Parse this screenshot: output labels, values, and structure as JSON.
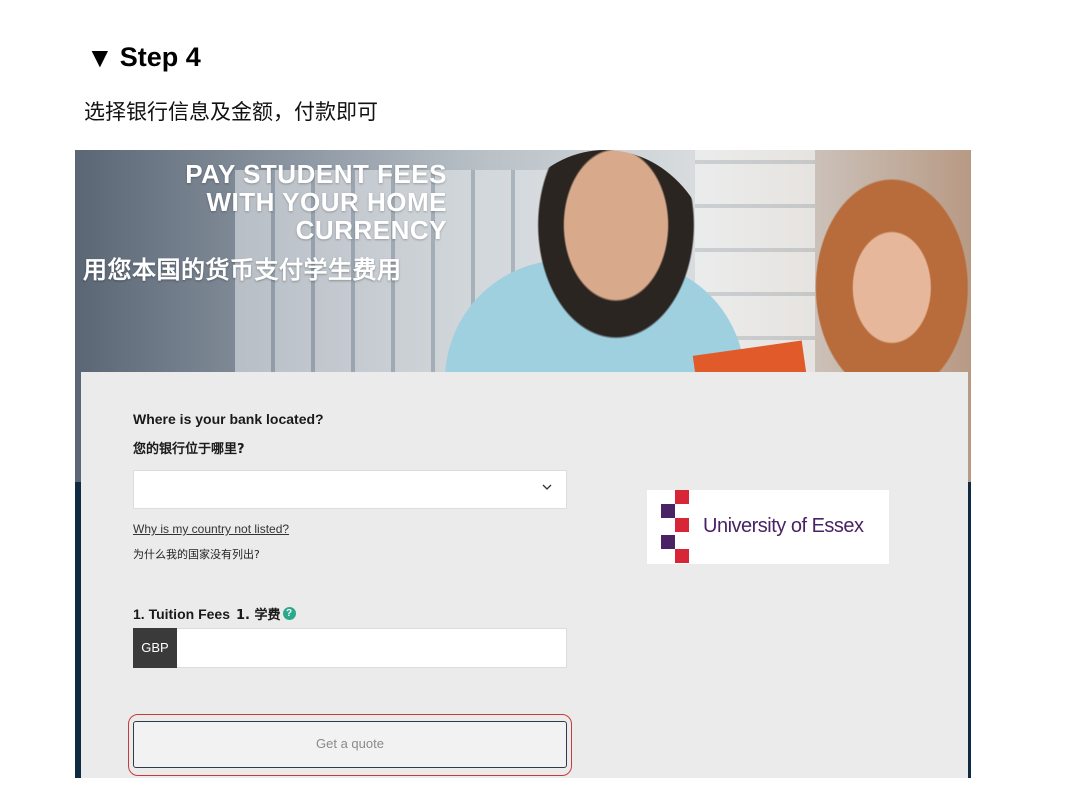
{
  "step": {
    "marker": "▼",
    "title": "Step 4",
    "description": "选择银行信息及金额，付款即可"
  },
  "hero": {
    "lines_en": [
      "PAY STUDENT FEES",
      "WITH YOUR HOME",
      "CURRENCY"
    ],
    "line_cn": "用您本国的货币支付学生费用"
  },
  "form": {
    "bank_label_en": "Where is your bank located?",
    "bank_label_cn": "您的银行位于哪里?",
    "bank_select_value": "",
    "chevron_icon": "chevron-down-icon",
    "country_link_en": "Why is my country not listed?",
    "country_link_cn": "为什么我的国家没有列出?",
    "tuition_label_en": "1. Tuition Fees",
    "tuition_label_cn": "1. 学费",
    "help_icon": "question-circle-icon",
    "currency": "GBP",
    "amount_value": "",
    "quote_button": "Get a quote"
  },
  "university": {
    "name": "University of Essex",
    "colors": {
      "purple": "#4a2365",
      "red": "#d72638"
    }
  },
  "colors": {
    "panel_bg": "#ebebeb",
    "highlight": "#c93b3b",
    "button_border": "#2f3b48"
  }
}
